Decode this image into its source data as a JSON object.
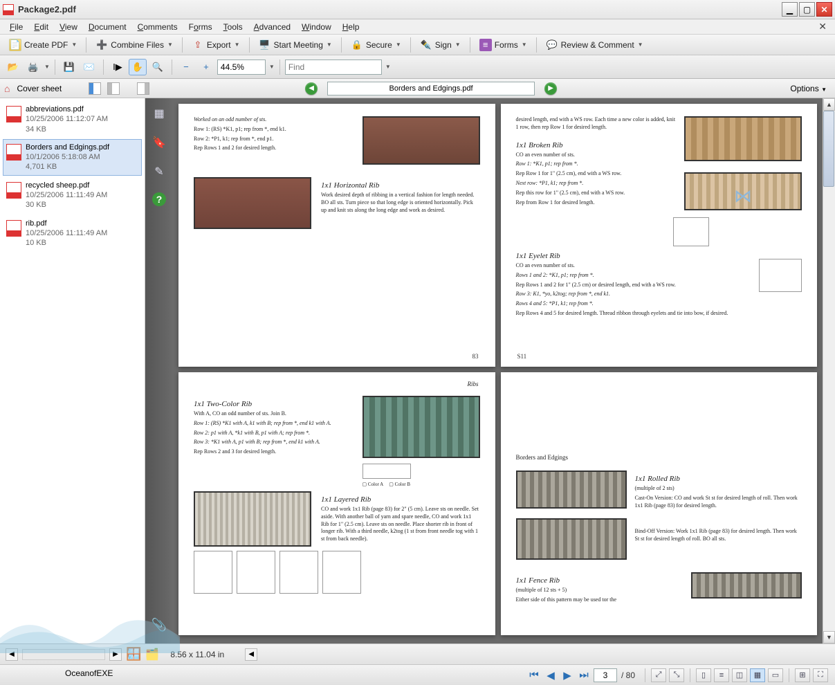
{
  "window": {
    "title": "Package2.pdf"
  },
  "menus": [
    "File",
    "Edit",
    "View",
    "Document",
    "Comments",
    "Forms",
    "Tools",
    "Advanced",
    "Window",
    "Help"
  ],
  "toolbar1": {
    "create": "Create PDF",
    "combine": "Combine Files",
    "export": "Export",
    "start": "Start Meeting",
    "secure": "Secure",
    "sign": "Sign",
    "forms": "Forms",
    "review": "Review & Comment"
  },
  "toolbar2": {
    "zoom": "44.5%",
    "find_placeholder": "Find"
  },
  "navhead": {
    "cover": "Cover sheet",
    "docname": "Borders and Edgings.pdf",
    "options": "Options"
  },
  "files": [
    {
      "name": "abbreviations.pdf",
      "date": "10/25/2006 11:12:07 AM",
      "size": "34 KB"
    },
    {
      "name": "Borders and Edgings.pdf",
      "date": "10/1/2006 5:18:08 AM",
      "size": "4,701 KB"
    },
    {
      "name": "recycled sheep.pdf",
      "date": "10/25/2006 11:11:49 AM",
      "size": "30 KB"
    },
    {
      "name": "rib.pdf",
      "date": "10/25/2006 11:11:49 AM",
      "size": "10 KB"
    }
  ],
  "doc": {
    "p1": {
      "intro": "Worked on an odd number of sts.",
      "r1": "Row 1: (RS) *K1, p1; rep from *, end k1.",
      "r2": "Row 2: *P1, k1; rep from *, end p1.",
      "r3": "Rep Rows 1 and 2 for desired length.",
      "t2": "1x1   Horizontal   Rib",
      "d2": "Work desired depth of ribbing in a vertical fashion for length needed. BO all sts. Turn piece so that long edge is oriented horizontally. Pick up and knit sts along the long edge and work as desired.",
      "foot": "83"
    },
    "p2": {
      "intro": "desired length, end with a WS row. Each time a new color is added, knit 1 row, then rep Row 1 for desired length.",
      "t1": "1x1   Broken   Rib",
      "d1a": "CO an even number of sts.",
      "d1b": "Row 1: *K1, p1; rep from *.",
      "d1c": "Rep Row 1 for 1\" (2.5 cm), end with a WS row.",
      "d1d": "Next row: *P1, k1; rep from *.",
      "d1e": "Rep this row for 1\" (2.5 cm), end with a WS row.",
      "d1f": "Rep from Row 1 for desired length.",
      "t2": "1x1  Eyelet  Rib",
      "d2a": "CO an even number of sts.",
      "d2b": "Rows 1 and 2: *K1, p1; rep from *.",
      "d2c": "Rep Rows 1 and 2 for 1\" (2.5 cm) or desired length, end with a WS row.",
      "d2d": "Row 3: K1, *yo, k2tog; rep from *, end k1.",
      "d2e": "Rows 4 and 5: *P1, k1; rep from *.",
      "d2f": "Rep Rows 4 and 5 for desired length. Thread ribbon through eyelets and tie into bow, if desired.",
      "foot": "S11"
    },
    "p3": {
      "hdr": "Ribs",
      "t1": "1x1   Two-Color   Rib",
      "d1a": "With A, CO an odd number of sts. Join B.",
      "d1b": "Row 1: (RS) *K1 with A, k1 with B; rep from *, end k1 with A.",
      "d1c": "Row 2: p1 with A, *k1 with B, p1 with A; rep from *.",
      "d1d": "Row 3: *K1 with A, p1 with B; rep from *, end k1 with A.",
      "d1e": "Rep Rows 2 and 3 for desired length.",
      "t2": "1x1  Layered  Rib",
      "d2": "CO and work 1x1 Rib (page 83) for 2\" (5 cm). Leave sts on needle. Set aside. With another ball of yarn and spare needle, CO and work 1x1 Rib for 1\" (2.5 cm). Leave sts on needle. Place shorter rib in front of longer rib. With a third needle, k2tog (1 st from front needle tog with 1 st from back needle).",
      "leg1": "Color A",
      "leg2": "Color B"
    },
    "p4": {
      "hdr": "Borders and Edgings",
      "t1": "1x1   Rolled   Rib",
      "d1a": "(multiple of 2 sts)",
      "d1b": "Cast-On Version: CO and work St st for desired length of roll. Then work 1x1 Rib (page 83) for desired length.",
      "d1c": "Bind-Off Version: Work 1x1 Rib (page 83) for desired length. Then work St st for desired length of roll. BO all sts.",
      "t2": "1x1   Fence   Rib",
      "d2a": "(multiple of 12 sts + 5)",
      "d2b": "Either side of this pattern may be used tor the"
    }
  },
  "status": {
    "dim": "8.56 x 11.04 in"
  },
  "pagebar": {
    "current": "3",
    "total": "/ 80"
  },
  "watermark": "OceanofEXE"
}
